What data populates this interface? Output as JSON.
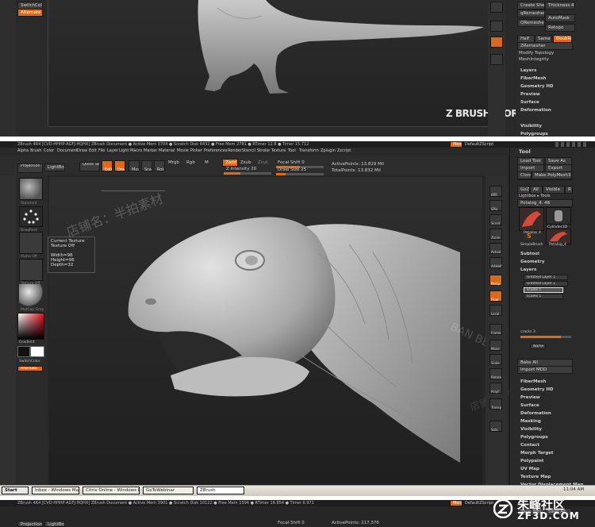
{
  "top_panel": {
    "left_tags": [
      "SwitchColor",
      "Alternate"
    ],
    "watermark": "Z BRUSH WORKSHOPS",
    "right_buttons": [
      "Create Shell",
      "Thickness 4",
      "qRemesher",
      "AutoMask",
      "QRemesher",
      "Retopo",
      "Half",
      "Same",
      "Double",
      "ZRemesher",
      "Modify Topology",
      "MeshIntegrity"
    ],
    "right_menu": [
      "Layers",
      "FiberMesh",
      "Geometry HD",
      "Preview",
      "Surface",
      "Deformation",
      "Visibility",
      "Polygroups"
    ]
  },
  "title_bar": {
    "text": "ZBrush 4R4 [CVD-HHHP-AGFJ-HQHX]   ZBrush Document   ● Active Mem 3704 ● Scratch Disk 6432 ● Free Mem 2781 ● RTimer 12.8 ● Timer 15.712",
    "menus_btn": "Menus",
    "script_label": "DefaultZScript"
  },
  "menu_bar": [
    "Alpha",
    "Brush",
    "Color",
    "Document",
    "Draw",
    "Edit",
    "File",
    "Layer",
    "Light",
    "Macro",
    "Marker",
    "Material",
    "Movie",
    "Picker",
    "Preferences",
    "Render",
    "Stencil",
    "Stroke",
    "Texture",
    "Tool",
    "Transform",
    "Zplugin",
    "Zscript"
  ],
  "toolbar": {
    "projection_master": "Projection Master",
    "lightbox": "LightBox",
    "quick_sketch": "Quick Sketch",
    "edit": "Edit",
    "draw": "Draw",
    "move": "Move",
    "scale": "Scale",
    "rotate": "Rotate",
    "mrgb": "Mrgb",
    "rgb": "Rgb",
    "m": "M",
    "zadd": "Zadd",
    "zsub": "Zsub",
    "zcut": "Zcut",
    "z_intensity": "Z Intensity 20",
    "focal_shift": "Focal Shift 0",
    "draw_size": "Draw Size 25",
    "active_points": "ActivePoints: 13.829 Mil",
    "total_points": "TotalPoints: 13.832 Mil"
  },
  "left_shelf": {
    "labels": [
      "Standard",
      "DragRect",
      "Alpha Off",
      "Texture Off",
      "MatCap Gray"
    ],
    "gradient_label": "Gradient",
    "switch_color": "SwitchColor",
    "alternate": "Alternate"
  },
  "tooltip": {
    "line1": "Current Texture",
    "line2": "Texture Off",
    "width": "Width=96",
    "height": "Height=96",
    "depth": "Depth=32"
  },
  "right_shelf": [
    "BPR",
    "SPix",
    "Scroll",
    "Zoom",
    "Actual",
    "AAHalf",
    "Persp",
    "Floor",
    "Local",
    "Frame",
    "Move",
    "Scale",
    "Rotate",
    "PolyF",
    "Transp",
    "Solo"
  ],
  "tool_palette": {
    "header": "Tool",
    "buttons": [
      "Load Tool",
      "Save As",
      "Import",
      "Export",
      "Clone",
      "Make PolyMesh3D",
      "GoZ",
      "All",
      "Visible",
      "R",
      "Lightbox ▸ Tools"
    ],
    "current_tool": "Potalog_4. 48",
    "thumbs": [
      "Potalog_4",
      "Cylinder3D",
      "PolyMesh3D",
      "SimpleBrush",
      "Potalog_4"
    ],
    "sections": [
      "Subtool",
      "Geometry",
      "Layers",
      "FiberMesh",
      "Geometry HD",
      "Preview",
      "Surface",
      "Deformation",
      "Masking",
      "Visibility",
      "Polygroups",
      "Contact",
      "Morph Target",
      "Polypaint",
      "UV Map",
      "Texture Map",
      "Vector Displacement Map"
    ],
    "layers": [
      "Untitled Layer 1",
      "Untitled Layer 1",
      "scales 1",
      "scales 1"
    ],
    "cracks": "cracks 3",
    "name": "Name",
    "bake_all": "Bake All",
    "import_mdd": "Import MDD"
  },
  "watermarks": [
    "店铺名：半拍素材",
    "BAN BEAT",
    "店铺名：半拍素材"
  ],
  "taskbar": {
    "start": "Start",
    "items": [
      "Inbox - Windows Mail",
      "Citrix Online - Windows I...",
      "GoToWebinar",
      "ZBrush"
    ],
    "clock": "11:04 AM"
  },
  "bottom_panel": {
    "title_text": "ZBrush 4R4 [CVD-HHHP-AGFJ-HQHX]   ZBrush Document   ● Active Mem 3901 ● Scratch Disk 10122 ● Free Mem 1594 ● RTimer 16.854 ● Timer 6.971",
    "menus_btn": "Menus",
    "script_label": "DefaultZScript",
    "save_tool": "Save Tool",
    "save_as": "Save As",
    "projection_master": "Projection Master",
    "lightbox": "LightBox",
    "active_points": "ActivePoints: 217,376",
    "focal_shift": "Focal Shift 0"
  },
  "site_logo": {
    "cn": "朱峰社区",
    "url": "ZF3D.COM"
  }
}
